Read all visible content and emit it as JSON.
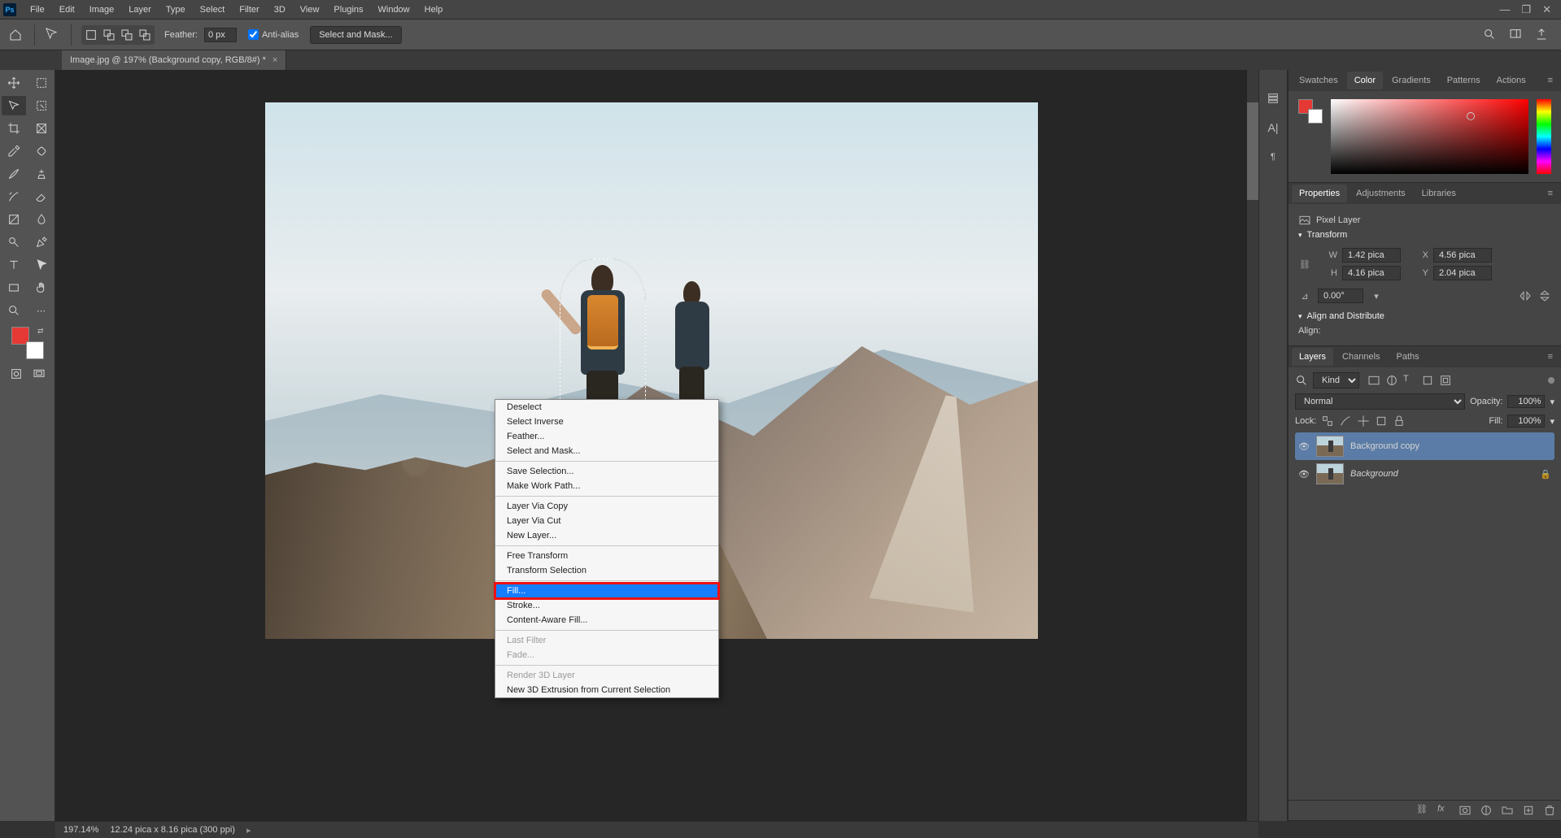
{
  "menubar": {
    "items": [
      "File",
      "Edit",
      "Image",
      "Layer",
      "Type",
      "Select",
      "Filter",
      "3D",
      "View",
      "Plugins",
      "Window",
      "Help"
    ]
  },
  "optionsbar": {
    "feather_label": "Feather:",
    "feather_value": "0 px",
    "antialias_label": "Anti-alias",
    "select_mask_btn": "Select and Mask..."
  },
  "document": {
    "tab_title": "Image.jpg @ 197% (Background copy, RGB/8#) *"
  },
  "context_menu": {
    "groups": [
      [
        "Deselect",
        "Select Inverse",
        "Feather...",
        "Select and Mask..."
      ],
      [
        "Save Selection...",
        "Make Work Path..."
      ],
      [
        "Layer Via Copy",
        "Layer Via Cut",
        "New Layer..."
      ],
      [
        "Free Transform",
        "Transform Selection"
      ],
      [
        "Fill...",
        "Stroke...",
        "Content-Aware Fill..."
      ],
      [
        "Last Filter",
        "Fade..."
      ],
      [
        "Render 3D Layer",
        "New 3D Extrusion from Current Selection"
      ]
    ],
    "disabled": [
      "Last Filter",
      "Fade...",
      "Render 3D Layer"
    ],
    "highlighted": "Fill..."
  },
  "right_panels": {
    "color_tabs": [
      "Swatches",
      "Color",
      "Gradients",
      "Patterns",
      "Actions"
    ],
    "color_active": "Color",
    "properties_tabs": [
      "Properties",
      "Adjustments",
      "Libraries"
    ],
    "properties_active": "Properties",
    "properties": {
      "type_label": "Pixel Layer",
      "transform_hdr": "Transform",
      "W": "1.42 pica",
      "X": "4.56 pica",
      "H": "4.16 pica",
      "Y": "2.04 pica",
      "angle": "0.00°",
      "align_hdr": "Align and Distribute",
      "align_label": "Align:"
    },
    "layers_tabs": [
      "Layers",
      "Channels",
      "Paths"
    ],
    "layers_active": "Layers",
    "layers": {
      "kind_label": "Kind",
      "blend_mode": "Normal",
      "opacity_label": "Opacity:",
      "opacity_value": "100%",
      "lock_label": "Lock:",
      "fill_label": "Fill:",
      "fill_value": "100%",
      "items": [
        {
          "name": "Background copy",
          "locked": false,
          "selected": true,
          "italic": false
        },
        {
          "name": "Background",
          "locked": true,
          "selected": false,
          "italic": true
        }
      ]
    }
  },
  "statusbar": {
    "zoom": "197.14%",
    "doc_info": "12.24 pica x 8.16 pica (300 ppi)"
  },
  "colors": {
    "accent": "#167dff",
    "foreground_swatch": "#e53935"
  }
}
